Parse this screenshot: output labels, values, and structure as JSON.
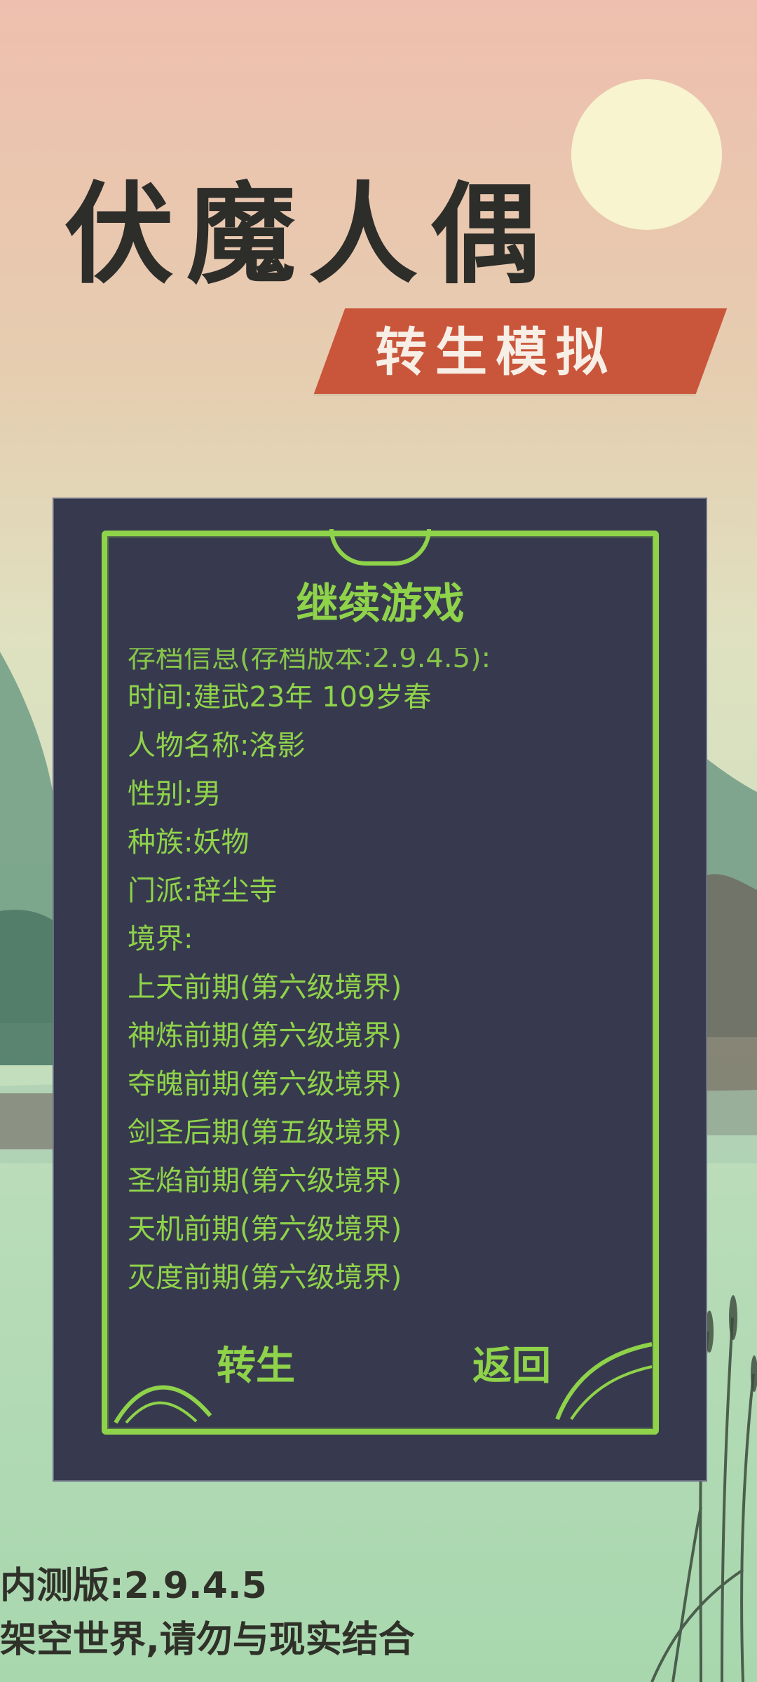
{
  "header": {
    "title": "伏魔人偶",
    "subtitle": "转生模拟"
  },
  "panel": {
    "title": "继续游戏",
    "cut_line": "存档信息(存档版本:2.9.4.5):",
    "lines": [
      "时间:建武23年  109岁春",
      "人物名称:洛影",
      "性别:男",
      "种族:妖物",
      "门派:辞尘寺",
      "境界:",
      "上天前期(第六级境界)",
      "神炼前期(第六级境界)",
      "夺魄前期(第六级境界)",
      "剑圣后期(第五级境界)",
      "圣焰前期(第六级境界)",
      "天机前期(第六级境界)",
      "灭度前期(第六级境界)"
    ],
    "buttons": {
      "rebirth": "转生",
      "back": "返回"
    }
  },
  "footer": {
    "version": "内测版:2.9.4.5",
    "disclaimer": "架空世界,请勿与现实结合"
  },
  "colors": {
    "accent_green": "#8fd34a",
    "panel_bg": "#373a4e",
    "banner_red": "#c9563b",
    "title_dark": "#2d2d2a"
  },
  "icons": [
    "sun-decoration",
    "mountain-scenery",
    "reed-grass",
    "leaf-ornament"
  ]
}
